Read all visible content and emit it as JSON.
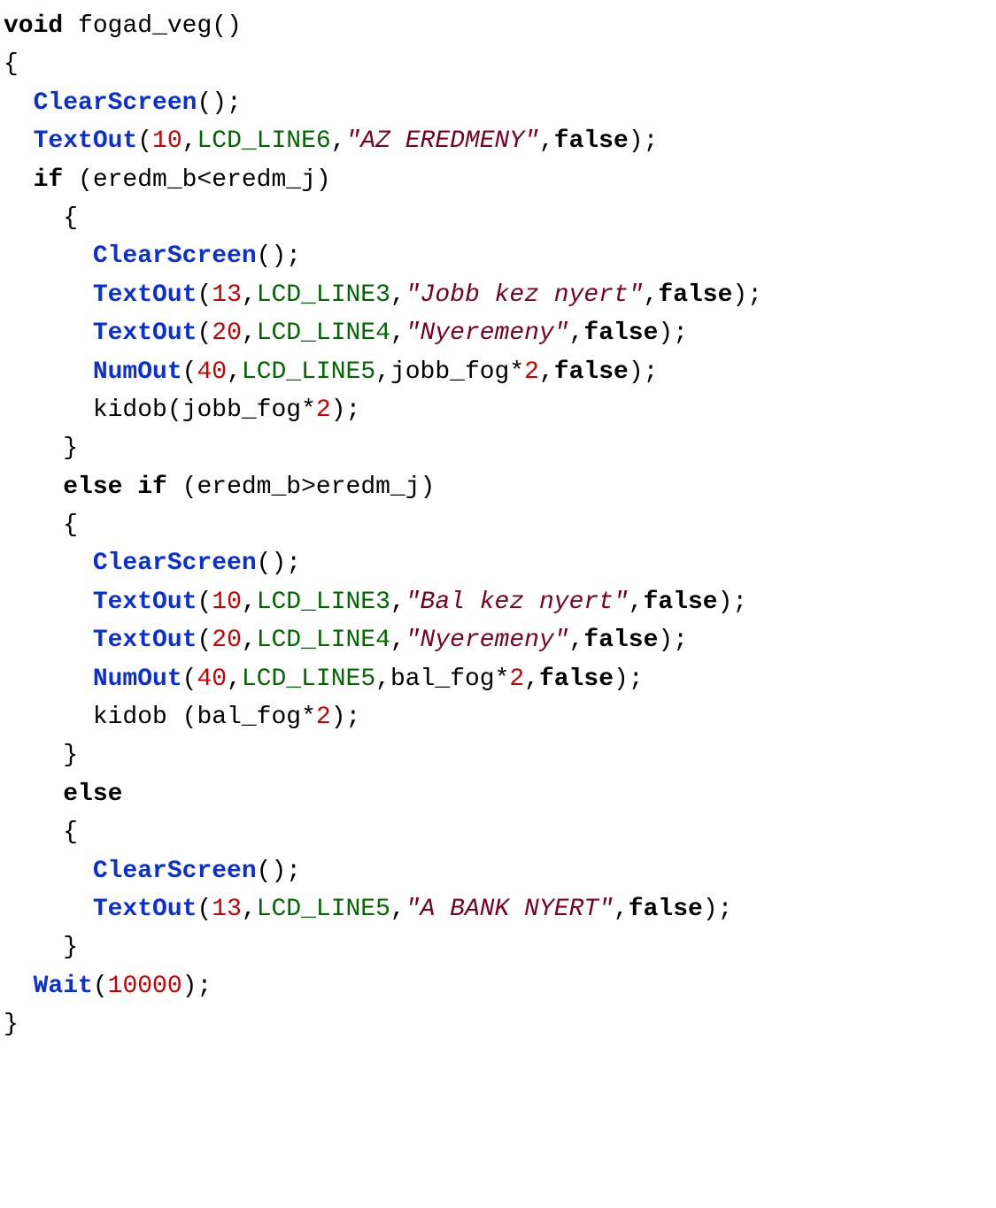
{
  "lines": [
    [
      {
        "cls": "kw",
        "t": "void"
      },
      {
        "cls": "punc",
        "t": " "
      },
      {
        "cls": "id",
        "t": "fogad_veg"
      },
      {
        "cls": "punc",
        "t": "()"
      }
    ],
    [
      {
        "cls": "punc",
        "t": "{"
      }
    ],
    [
      {
        "cls": "punc",
        "t": "  "
      },
      {
        "cls": "fn",
        "t": "ClearScreen"
      },
      {
        "cls": "punc",
        "t": "();"
      }
    ],
    [
      {
        "cls": "punc",
        "t": "  "
      },
      {
        "cls": "fn",
        "t": "TextOut"
      },
      {
        "cls": "punc",
        "t": "("
      },
      {
        "cls": "num",
        "t": "10"
      },
      {
        "cls": "punc",
        "t": ","
      },
      {
        "cls": "cnst",
        "t": "LCD_LINE6"
      },
      {
        "cls": "punc",
        "t": ","
      },
      {
        "cls": "str",
        "t": "\"AZ EREDMENY\""
      },
      {
        "cls": "punc",
        "t": ","
      },
      {
        "cls": "boolv",
        "t": "false"
      },
      {
        "cls": "punc",
        "t": ");"
      }
    ],
    [
      {
        "cls": "punc",
        "t": "  "
      },
      {
        "cls": "kw",
        "t": "if"
      },
      {
        "cls": "punc",
        "t": " ("
      },
      {
        "cls": "id",
        "t": "eredm_b"
      },
      {
        "cls": "punc",
        "t": "<"
      },
      {
        "cls": "id",
        "t": "eredm_j"
      },
      {
        "cls": "punc",
        "t": ")"
      }
    ],
    [
      {
        "cls": "punc",
        "t": "    {"
      }
    ],
    [
      {
        "cls": "punc",
        "t": "      "
      },
      {
        "cls": "fn",
        "t": "ClearScreen"
      },
      {
        "cls": "punc",
        "t": "();"
      }
    ],
    [
      {
        "cls": "punc",
        "t": "      "
      },
      {
        "cls": "fn",
        "t": "TextOut"
      },
      {
        "cls": "punc",
        "t": "("
      },
      {
        "cls": "num",
        "t": "13"
      },
      {
        "cls": "punc",
        "t": ","
      },
      {
        "cls": "cnst",
        "t": "LCD_LINE3"
      },
      {
        "cls": "punc",
        "t": ","
      },
      {
        "cls": "str",
        "t": "\"Jobb kez nyert\""
      },
      {
        "cls": "punc",
        "t": ","
      },
      {
        "cls": "boolv",
        "t": "false"
      },
      {
        "cls": "punc",
        "t": ");"
      }
    ],
    [
      {
        "cls": "punc",
        "t": "      "
      },
      {
        "cls": "fn",
        "t": "TextOut"
      },
      {
        "cls": "punc",
        "t": "("
      },
      {
        "cls": "num",
        "t": "20"
      },
      {
        "cls": "punc",
        "t": ","
      },
      {
        "cls": "cnst",
        "t": "LCD_LINE4"
      },
      {
        "cls": "punc",
        "t": ","
      },
      {
        "cls": "str",
        "t": "\"Nyeremeny\""
      },
      {
        "cls": "punc",
        "t": ","
      },
      {
        "cls": "boolv",
        "t": "false"
      },
      {
        "cls": "punc",
        "t": ");"
      }
    ],
    [
      {
        "cls": "punc",
        "t": "      "
      },
      {
        "cls": "fn",
        "t": "NumOut"
      },
      {
        "cls": "punc",
        "t": "("
      },
      {
        "cls": "num",
        "t": "40"
      },
      {
        "cls": "punc",
        "t": ","
      },
      {
        "cls": "cnst",
        "t": "LCD_LINE5"
      },
      {
        "cls": "punc",
        "t": ","
      },
      {
        "cls": "id",
        "t": "jobb_fog"
      },
      {
        "cls": "punc",
        "t": "*"
      },
      {
        "cls": "num",
        "t": "2"
      },
      {
        "cls": "punc",
        "t": ","
      },
      {
        "cls": "boolv",
        "t": "false"
      },
      {
        "cls": "punc",
        "t": ");"
      }
    ],
    [
      {
        "cls": "punc",
        "t": "      "
      },
      {
        "cls": "id",
        "t": "kidob"
      },
      {
        "cls": "punc",
        "t": "("
      },
      {
        "cls": "id",
        "t": "jobb_fog"
      },
      {
        "cls": "punc",
        "t": "*"
      },
      {
        "cls": "num",
        "t": "2"
      },
      {
        "cls": "punc",
        "t": ");"
      }
    ],
    [
      {
        "cls": "punc",
        "t": "    }"
      }
    ],
    [
      {
        "cls": "punc",
        "t": "    "
      },
      {
        "cls": "kw",
        "t": "else"
      },
      {
        "cls": "punc",
        "t": " "
      },
      {
        "cls": "kw",
        "t": "if"
      },
      {
        "cls": "punc",
        "t": " ("
      },
      {
        "cls": "id",
        "t": "eredm_b"
      },
      {
        "cls": "punc",
        "t": ">"
      },
      {
        "cls": "id",
        "t": "eredm_j"
      },
      {
        "cls": "punc",
        "t": ")"
      }
    ],
    [
      {
        "cls": "punc",
        "t": "    {"
      }
    ],
    [
      {
        "cls": "punc",
        "t": "      "
      },
      {
        "cls": "fn",
        "t": "ClearScreen"
      },
      {
        "cls": "punc",
        "t": "();"
      }
    ],
    [
      {
        "cls": "punc",
        "t": "      "
      },
      {
        "cls": "fn",
        "t": "TextOut"
      },
      {
        "cls": "punc",
        "t": "("
      },
      {
        "cls": "num",
        "t": "10"
      },
      {
        "cls": "punc",
        "t": ","
      },
      {
        "cls": "cnst",
        "t": "LCD_LINE3"
      },
      {
        "cls": "punc",
        "t": ","
      },
      {
        "cls": "str",
        "t": "\"Bal kez nyert\""
      },
      {
        "cls": "punc",
        "t": ","
      },
      {
        "cls": "boolv",
        "t": "false"
      },
      {
        "cls": "punc",
        "t": ");"
      }
    ],
    [
      {
        "cls": "punc",
        "t": "      "
      },
      {
        "cls": "fn",
        "t": "TextOut"
      },
      {
        "cls": "punc",
        "t": "("
      },
      {
        "cls": "num",
        "t": "20"
      },
      {
        "cls": "punc",
        "t": ","
      },
      {
        "cls": "cnst",
        "t": "LCD_LINE4"
      },
      {
        "cls": "punc",
        "t": ","
      },
      {
        "cls": "str",
        "t": "\"Nyeremeny\""
      },
      {
        "cls": "punc",
        "t": ","
      },
      {
        "cls": "boolv",
        "t": "false"
      },
      {
        "cls": "punc",
        "t": ");"
      }
    ],
    [
      {
        "cls": "punc",
        "t": "      "
      },
      {
        "cls": "fn",
        "t": "NumOut"
      },
      {
        "cls": "punc",
        "t": "("
      },
      {
        "cls": "num",
        "t": "40"
      },
      {
        "cls": "punc",
        "t": ","
      },
      {
        "cls": "cnst",
        "t": "LCD_LINE5"
      },
      {
        "cls": "punc",
        "t": ","
      },
      {
        "cls": "id",
        "t": "bal_fog"
      },
      {
        "cls": "punc",
        "t": "*"
      },
      {
        "cls": "num",
        "t": "2"
      },
      {
        "cls": "punc",
        "t": ","
      },
      {
        "cls": "boolv",
        "t": "false"
      },
      {
        "cls": "punc",
        "t": ");"
      }
    ],
    [
      {
        "cls": "punc",
        "t": "      "
      },
      {
        "cls": "id",
        "t": "kidob"
      },
      {
        "cls": "punc",
        "t": " ("
      },
      {
        "cls": "id",
        "t": "bal_fog"
      },
      {
        "cls": "punc",
        "t": "*"
      },
      {
        "cls": "num",
        "t": "2"
      },
      {
        "cls": "punc",
        "t": ");"
      }
    ],
    [
      {
        "cls": "punc",
        "t": "    }"
      }
    ],
    [
      {
        "cls": "punc",
        "t": "    "
      },
      {
        "cls": "kw",
        "t": "else"
      }
    ],
    [
      {
        "cls": "punc",
        "t": "    {"
      }
    ],
    [
      {
        "cls": "punc",
        "t": "      "
      },
      {
        "cls": "fn",
        "t": "ClearScreen"
      },
      {
        "cls": "punc",
        "t": "();"
      }
    ],
    [
      {
        "cls": "punc",
        "t": "      "
      },
      {
        "cls": "fn",
        "t": "TextOut"
      },
      {
        "cls": "punc",
        "t": "("
      },
      {
        "cls": "num",
        "t": "13"
      },
      {
        "cls": "punc",
        "t": ","
      },
      {
        "cls": "cnst",
        "t": "LCD_LINE5"
      },
      {
        "cls": "punc",
        "t": ","
      },
      {
        "cls": "str",
        "t": "\"A BANK NYERT\""
      },
      {
        "cls": "punc",
        "t": ","
      },
      {
        "cls": "boolv",
        "t": "false"
      },
      {
        "cls": "punc",
        "t": ");"
      }
    ],
    [
      {
        "cls": "punc",
        "t": "    }"
      }
    ],
    [
      {
        "cls": "punc",
        "t": "  "
      },
      {
        "cls": "fn",
        "t": "Wait"
      },
      {
        "cls": "punc",
        "t": "("
      },
      {
        "cls": "num",
        "t": "10000"
      },
      {
        "cls": "punc",
        "t": ");"
      }
    ],
    [
      {
        "cls": "punc",
        "t": "}"
      }
    ]
  ]
}
